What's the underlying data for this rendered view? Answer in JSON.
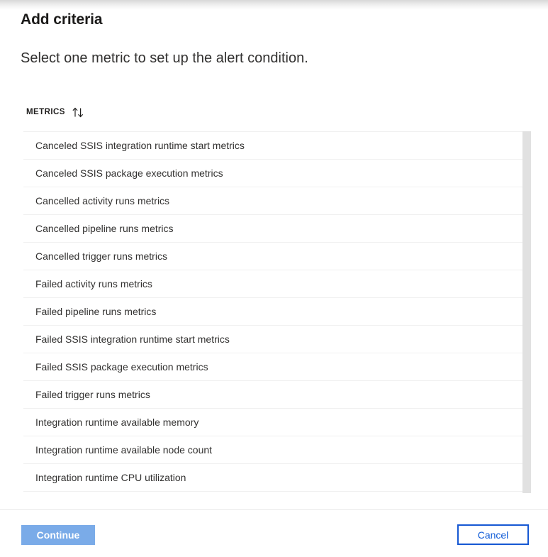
{
  "blade": {
    "title": "Add criteria",
    "subtitle": "Select one metric to set up the alert condition."
  },
  "metrics_list": {
    "column_header": "METRICS",
    "sort_icon": "sort-ascending-descending-icon",
    "items": [
      {
        "label": "Canceled SSIS integration runtime start metrics"
      },
      {
        "label": "Canceled SSIS package execution metrics"
      },
      {
        "label": "Cancelled activity runs metrics"
      },
      {
        "label": "Cancelled pipeline runs metrics"
      },
      {
        "label": "Cancelled trigger runs metrics"
      },
      {
        "label": "Failed activity runs metrics"
      },
      {
        "label": "Failed pipeline runs metrics"
      },
      {
        "label": "Failed SSIS integration runtime start metrics"
      },
      {
        "label": "Failed SSIS package execution metrics"
      },
      {
        "label": "Failed trigger runs metrics"
      },
      {
        "label": "Integration runtime available memory"
      },
      {
        "label": "Integration runtime available node count"
      },
      {
        "label": "Integration runtime CPU utilization"
      }
    ]
  },
  "footer": {
    "continue_label": "Continue",
    "cancel_label": "Cancel"
  },
  "colors": {
    "primary_button_bg": "#7aabe8",
    "primary_button_text": "#ffffff",
    "secondary_button_border": "#1658d3",
    "secondary_button_text": "#0f5bd7",
    "row_divider": "#f0f0f0",
    "scrollbar_thumb": "#e1e1e1",
    "text_primary": "#323130"
  }
}
